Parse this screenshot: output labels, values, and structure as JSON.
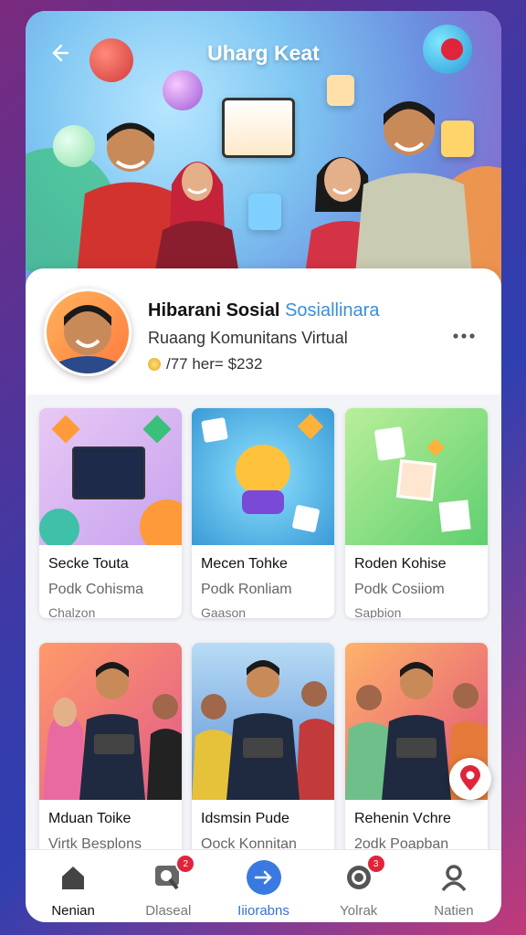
{
  "header": {
    "title": "Uharg Keat"
  },
  "profile": {
    "name": "Hibarani Sosial",
    "name_accent": "Sosiallinara",
    "subtitle": "Ruaang Komunitans Virtual",
    "stat": "/77 her= $232"
  },
  "cards": [
    {
      "title": "Secke Touta",
      "subtitle": "Podk Cohisma",
      "meta": "Chalzon"
    },
    {
      "title": "Mecen Tohke",
      "subtitle": "Podk Ronliam",
      "meta": "Gaason"
    },
    {
      "title": "Roden Kohise",
      "subtitle": "Podk Cosiiom",
      "meta": "Sapbion"
    },
    {
      "title": "Mduan Toike",
      "subtitle": "Virtk Besplons",
      "meta": ""
    },
    {
      "title": "Idsmsin Pude",
      "subtitle": "Oock Konnitan",
      "meta": ""
    },
    {
      "title": "Rehenin Vchre",
      "subtitle": "2odk Poapban",
      "meta": ""
    }
  ],
  "nav": [
    {
      "label": "Nenian",
      "icon": "home-icon"
    },
    {
      "label": "Dlaseal",
      "icon": "search-chat-icon",
      "badge": "2"
    },
    {
      "label": "Iiiorabns",
      "icon": "arrow-right-icon"
    },
    {
      "label": "Yolrak",
      "icon": "chat-icon",
      "badge": "3"
    },
    {
      "label": "Natien",
      "icon": "user-icon"
    }
  ],
  "colors": {
    "accent": "#3a8fd6",
    "active_nav": "#3a6fd6",
    "badge": "#e0243a"
  }
}
